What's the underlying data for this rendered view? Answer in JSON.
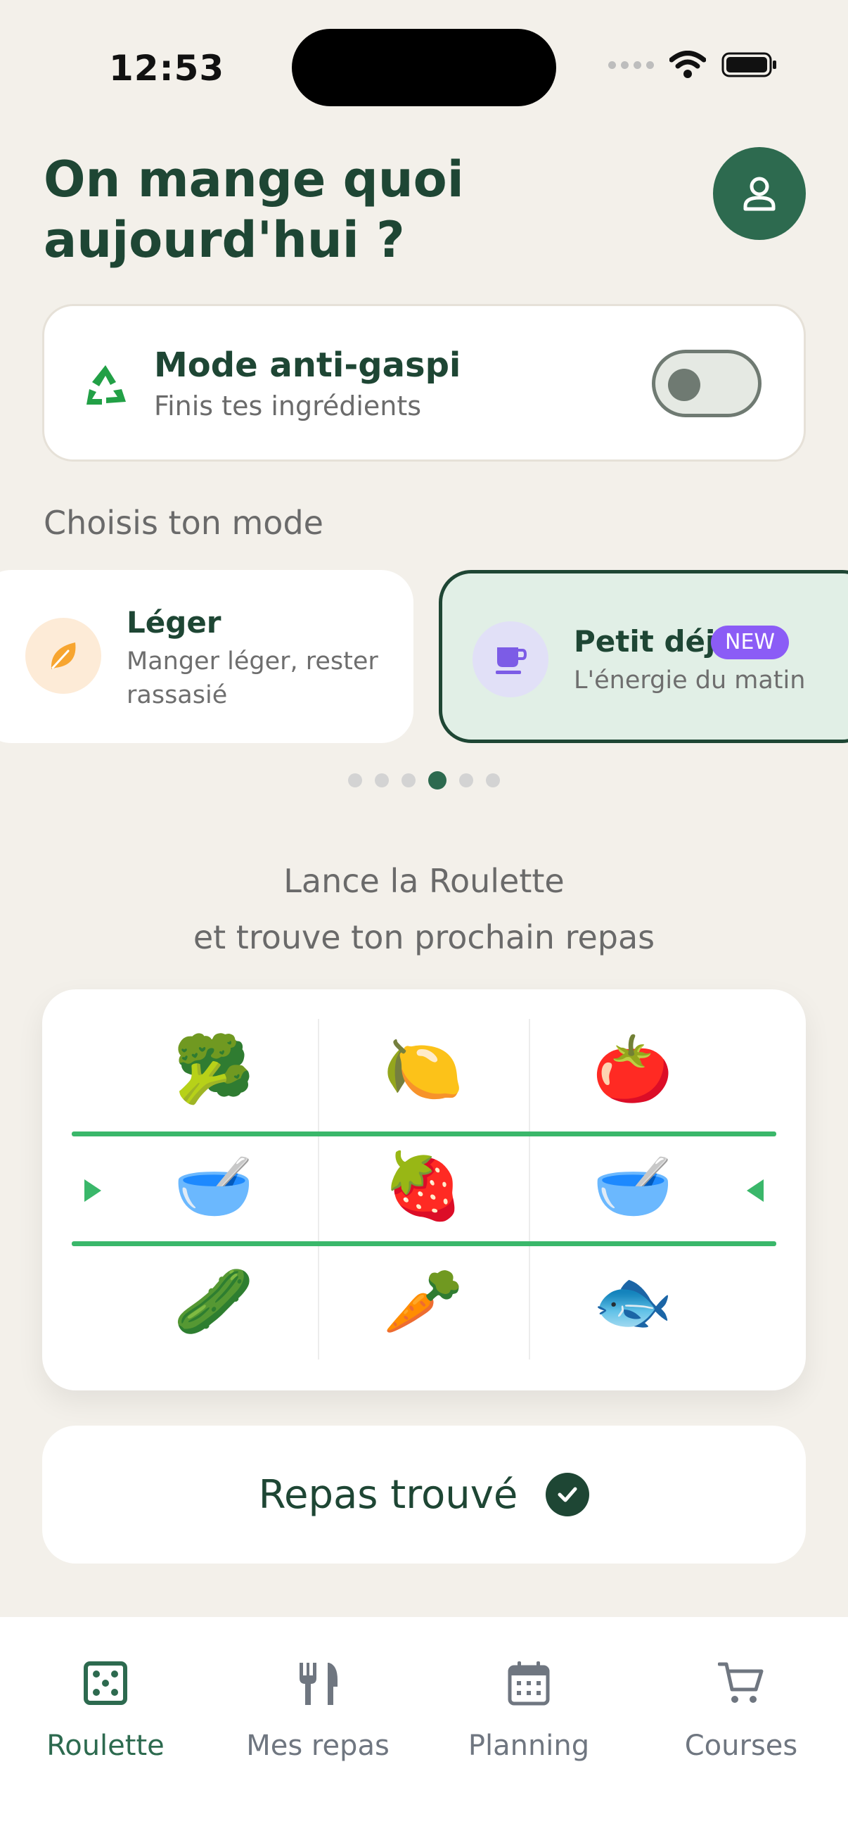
{
  "status_bar": {
    "time": "12:53"
  },
  "header": {
    "title": "On mange quoi aujourd'hui ?",
    "profile_icon": "person-icon"
  },
  "anti_gaspi": {
    "icon": "recycle-icon",
    "title": "Mode anti-gaspi",
    "subtitle": "Finis tes ingrédients",
    "enabled": false
  },
  "modes": {
    "label": "Choisis ton mode",
    "items": [
      {
        "title": "Léger",
        "subtitle": "Manger léger, rester rassasié",
        "icon": "leaf-icon",
        "color": "#F7A530"
      },
      {
        "title": "Petit déj",
        "subtitle": "L'énergie du matin",
        "badge": "NEW",
        "icon": "coffee-cup-icon",
        "color": "#7C5CE6",
        "selected": true
      }
    ],
    "page_count": 6,
    "active_page": 4
  },
  "prompt": {
    "line1": "Lance la Roulette",
    "line2": "et trouve ton prochain repas"
  },
  "roulette": {
    "rows": [
      [
        "🥦",
        "🍋",
        "🍅"
      ],
      [
        "🥣",
        "🍓",
        "🥣"
      ],
      [
        "🥒",
        "🥕",
        "🐟"
      ]
    ],
    "accent_color": "#3AB76A"
  },
  "result_button": {
    "label": "Repas trouvé",
    "icon": "check-circle-icon"
  },
  "tabbar": {
    "tabs": [
      {
        "label": "Roulette",
        "icon": "dice-icon",
        "active": true
      },
      {
        "label": "Mes repas",
        "icon": "utensils-icon"
      },
      {
        "label": "Planning",
        "icon": "calendar-icon"
      },
      {
        "label": "Courses",
        "icon": "cart-icon"
      }
    ]
  },
  "colors": {
    "brand": "#1E4634",
    "brand_fill": "#2D6A4F",
    "background": "#F3F0EA",
    "badge": "#8B5CF6"
  }
}
